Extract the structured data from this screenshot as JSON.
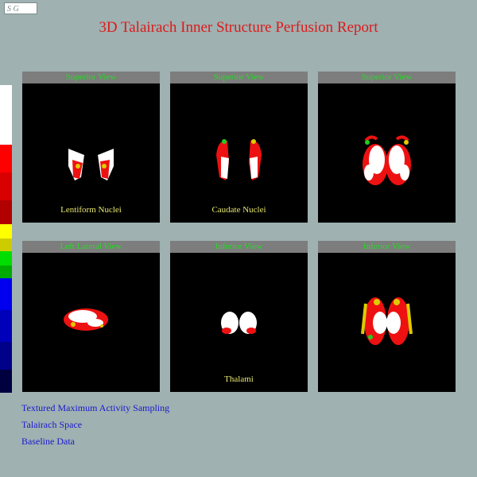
{
  "name_field": {
    "value": "S G"
  },
  "report_title": "3D Talairach Inner Structure Perfusion Report",
  "colorbar": {
    "colors": [
      "#ffffff",
      "#ffffff",
      "#ff0000",
      "#dd0000",
      "#b00000",
      "#ffff00",
      "#cccc00",
      "#00dd00",
      "#00aa00",
      "#0000ee",
      "#0000bb",
      "#000088",
      "#000055"
    ]
  },
  "panels": [
    {
      "header": "Superior View",
      "caption": "Lentiform Nuclei"
    },
    {
      "header": "Superior View",
      "caption": "Caudate Nuclei"
    },
    {
      "header": "Superior View",
      "caption": ""
    },
    {
      "header": "Left Lateral View",
      "caption": ""
    },
    {
      "header": "Inferior View",
      "caption": "Thalami"
    },
    {
      "header": "Inferior View",
      "caption": ""
    }
  ],
  "footer": [
    "Textured Maximum Activity Sampling",
    "Talairach Space",
    "Baseline Data"
  ]
}
